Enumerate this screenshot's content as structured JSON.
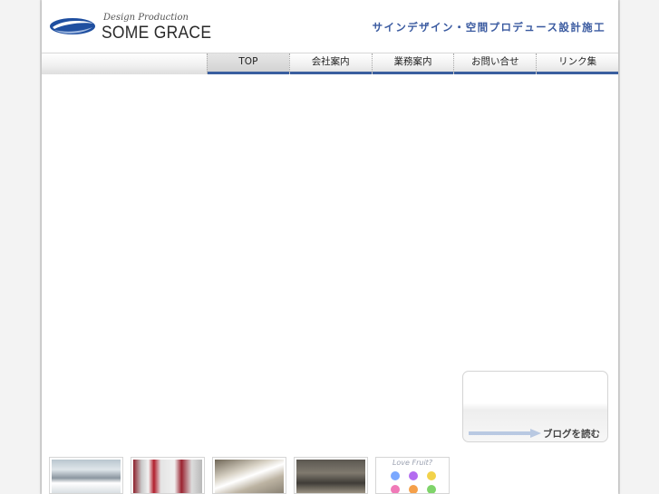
{
  "header": {
    "logo_tagline": "Design Production",
    "logo_name": "SOME GRACE",
    "tagline": "サインデザイン・空間プロデュース設計施工"
  },
  "nav": {
    "items": [
      {
        "label": "TOP",
        "active": true
      },
      {
        "label": "会社案内",
        "active": false
      },
      {
        "label": "業務案内",
        "active": false
      },
      {
        "label": "お問い合せ",
        "active": false
      },
      {
        "label": "リンク集",
        "active": false
      }
    ]
  },
  "blog": {
    "label": "ブログを読む"
  },
  "thumbnails": {
    "love_fruit_label": "Love Fruit?"
  },
  "colors": {
    "brand_blue": "#3a5f9f",
    "tagline_blue": "#3a5aa0"
  }
}
